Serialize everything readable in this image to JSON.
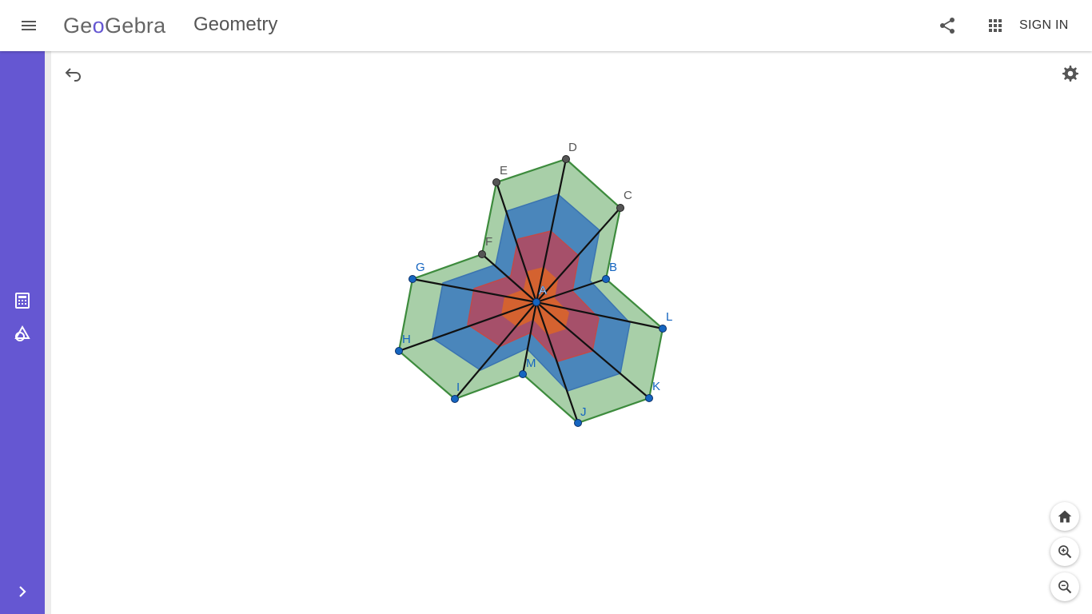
{
  "header": {
    "logo_left": "Ge",
    "logo_oo": "o",
    "logo_right": "Gebra",
    "app_title": "Geometry",
    "signin_label": "SIGN IN",
    "icons": [
      "menu-icon",
      "share-icon",
      "apps-icon"
    ]
  },
  "sidebar": {
    "items": [
      {
        "name": "calculator-icon"
      },
      {
        "name": "geometry-tools-icon"
      },
      {
        "name": "chevron-right-icon"
      }
    ],
    "color": "#6557d2"
  },
  "toolbar": {
    "icons": [
      "undo-icon",
      "settings-icon"
    ]
  },
  "zoom_controls": [
    "home-icon",
    "zoom-in-icon",
    "zoom-out-icon"
  ],
  "construction": {
    "center_label": "A",
    "gray_points": [
      "C",
      "D",
      "E",
      "F"
    ],
    "blue_points": [
      "B",
      "G",
      "H",
      "I",
      "J",
      "K",
      "L",
      "M"
    ],
    "colors": {
      "outer_fill": "#a8cfa8",
      "outer_stroke": "#3d8b3d",
      "blue_fill": "#4a86bb",
      "red_fill": "#a6506a",
      "orange_fill": "#d9642a",
      "point_blue": "#1565c0",
      "point_gray": "#555555"
    }
  }
}
